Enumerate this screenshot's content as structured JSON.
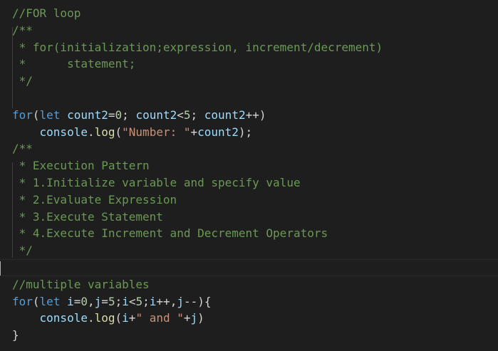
{
  "editor": {
    "lines": [
      [
        {
          "t": "//FOR loop",
          "c": "c"
        }
      ],
      [
        {
          "t": "/**",
          "c": "c"
        }
      ],
      [
        {
          "t": " * for(initialization;expression, increment/decrement)",
          "c": "c"
        }
      ],
      [
        {
          "t": " *      statement;",
          "c": "c"
        }
      ],
      [
        {
          "t": " */",
          "c": "c"
        }
      ],
      [],
      [
        {
          "t": "for",
          "c": "k"
        },
        {
          "t": "(",
          "c": "p"
        },
        {
          "t": "let",
          "c": "k"
        },
        {
          "t": " ",
          "c": "p"
        },
        {
          "t": "count2",
          "c": "v"
        },
        {
          "t": "=",
          "c": "p"
        },
        {
          "t": "0",
          "c": "n"
        },
        {
          "t": "; ",
          "c": "p"
        },
        {
          "t": "count2",
          "c": "v"
        },
        {
          "t": "<",
          "c": "p"
        },
        {
          "t": "5",
          "c": "n"
        },
        {
          "t": "; ",
          "c": "p"
        },
        {
          "t": "count2",
          "c": "v"
        },
        {
          "t": "++)",
          "c": "p"
        }
      ],
      [
        {
          "t": "    ",
          "c": "p"
        },
        {
          "t": "console",
          "c": "v"
        },
        {
          "t": ".",
          "c": "p"
        },
        {
          "t": "log",
          "c": "f"
        },
        {
          "t": "(",
          "c": "p"
        },
        {
          "t": "\"Number: \"",
          "c": "s"
        },
        {
          "t": "+",
          "c": "p"
        },
        {
          "t": "count2",
          "c": "v"
        },
        {
          "t": ");",
          "c": "p"
        }
      ],
      [
        {
          "t": "/**",
          "c": "c"
        }
      ],
      [
        {
          "t": " * Execution Pattern",
          "c": "c"
        }
      ],
      [
        {
          "t": " * 1.Initialize variable and specify value",
          "c": "c"
        }
      ],
      [
        {
          "t": " * 2.Evaluate Expression",
          "c": "c"
        }
      ],
      [
        {
          "t": " * 3.Execute Statement",
          "c": "c"
        }
      ],
      [
        {
          "t": " * 4.Execute Increment and Decrement Operators",
          "c": "c"
        }
      ],
      [
        {
          "t": " */",
          "c": "c"
        }
      ],
      [],
      [
        {
          "t": "//multiple variables",
          "c": "c"
        }
      ],
      [
        {
          "t": "for",
          "c": "k"
        },
        {
          "t": "(",
          "c": "p"
        },
        {
          "t": "let",
          "c": "k"
        },
        {
          "t": " ",
          "c": "p"
        },
        {
          "t": "i",
          "c": "v"
        },
        {
          "t": "=",
          "c": "p"
        },
        {
          "t": "0",
          "c": "n"
        },
        {
          "t": ",",
          "c": "p"
        },
        {
          "t": "j",
          "c": "v"
        },
        {
          "t": "=",
          "c": "p"
        },
        {
          "t": "5",
          "c": "n"
        },
        {
          "t": ";",
          "c": "p"
        },
        {
          "t": "i",
          "c": "v"
        },
        {
          "t": "<",
          "c": "p"
        },
        {
          "t": "5",
          "c": "n"
        },
        {
          "t": ";",
          "c": "p"
        },
        {
          "t": "i",
          "c": "v"
        },
        {
          "t": "++,",
          "c": "p"
        },
        {
          "t": "j",
          "c": "v"
        },
        {
          "t": "--){",
          "c": "p"
        }
      ],
      [
        {
          "t": "    ",
          "c": "p"
        },
        {
          "t": "console",
          "c": "v"
        },
        {
          "t": ".",
          "c": "p"
        },
        {
          "t": "log",
          "c": "f"
        },
        {
          "t": "(",
          "c": "p"
        },
        {
          "t": "i",
          "c": "v"
        },
        {
          "t": "+",
          "c": "p"
        },
        {
          "t": "\" and \"",
          "c": "s"
        },
        {
          "t": "+",
          "c": "p"
        },
        {
          "t": "j",
          "c": "v"
        },
        {
          "t": ")",
          "c": "p"
        }
      ],
      [
        {
          "t": "}",
          "c": "p"
        }
      ]
    ],
    "cursor_line": 15
  },
  "colors": {
    "background": "#1e1e1e",
    "comment": "#6a9955",
    "keyword": "#569cd6",
    "variable": "#9cdcfe",
    "number": "#b5cea8",
    "string": "#ce9178",
    "function": "#dcdcaa",
    "punctuation": "#d4d4d4"
  }
}
